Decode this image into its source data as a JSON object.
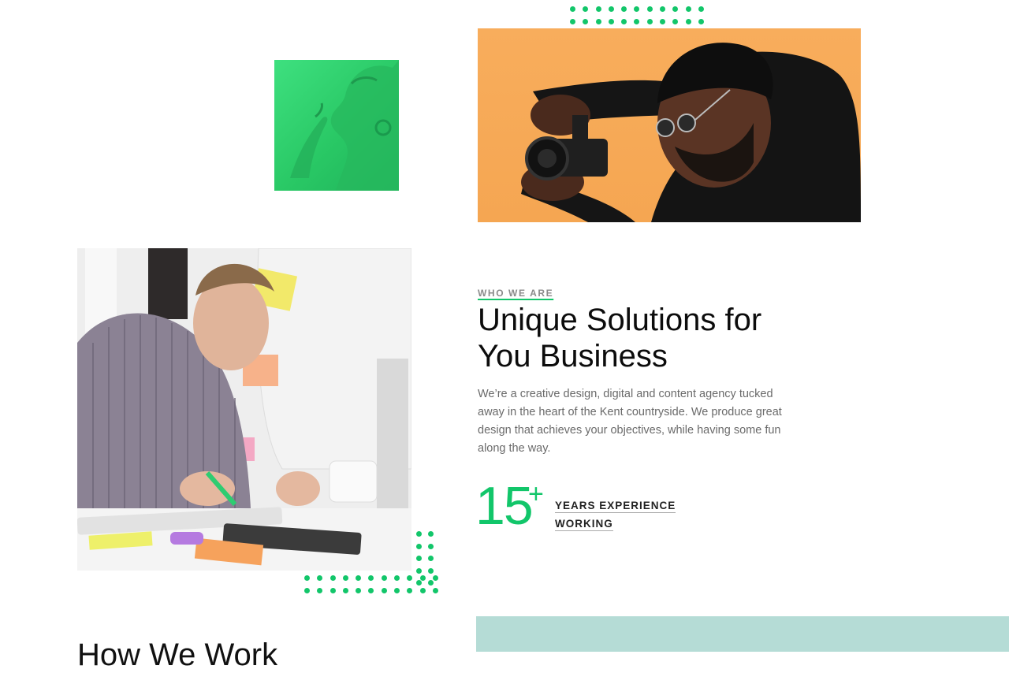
{
  "about": {
    "eyebrow": "WHO WE ARE",
    "headline": "Unique Solutions for You Business",
    "intro": "We’re a creative design, digital and content agency tucked away in the heart of the Kent countryside. We produce great design that achieves your objectives, while having some fun along the way.",
    "stat": {
      "number": "15",
      "suffix": "+",
      "label_line1": "YEARS EXPERIENCE",
      "label_line2": "WORKING"
    }
  },
  "next_section": {
    "heading": "How We Work"
  },
  "colors": {
    "accent": "#12c66a",
    "teal_block": "#b5dcd6",
    "photo_orange_bg": "#f6a856",
    "photo_green_bg": "#2fcf6c"
  },
  "photos": [
    {
      "name": "photo-green-portrait"
    },
    {
      "name": "photo-photographer"
    },
    {
      "name": "photo-designer-desk"
    }
  ]
}
